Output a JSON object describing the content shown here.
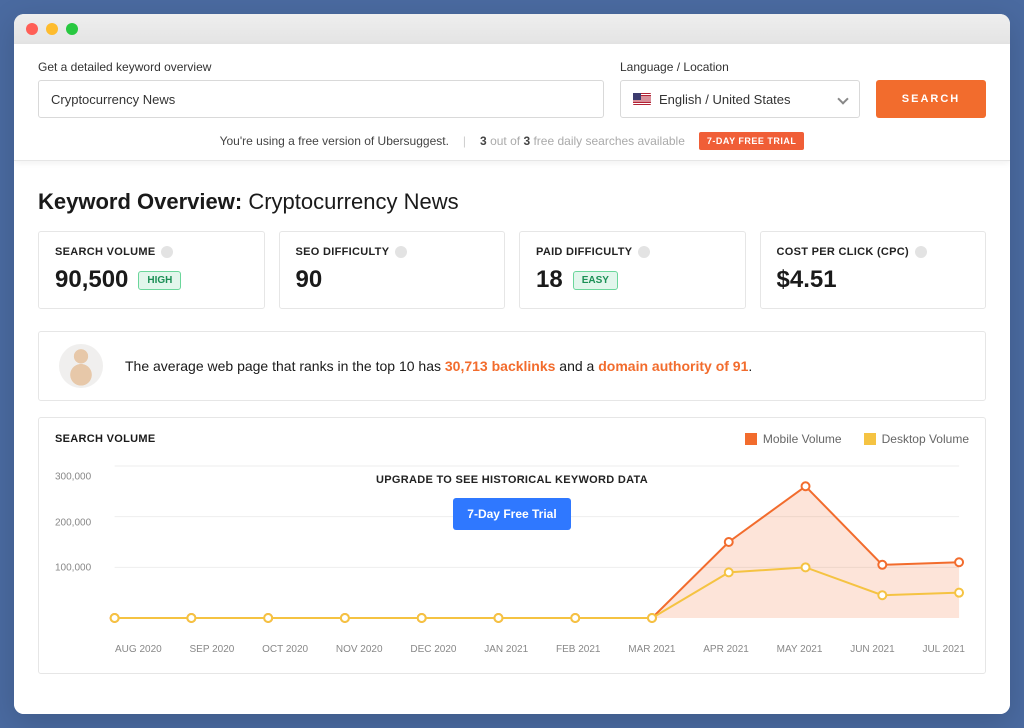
{
  "search": {
    "label": "Get a detailed keyword overview",
    "value": "Cryptocurrency News",
    "placeholder": ""
  },
  "location": {
    "label": "Language / Location",
    "value": "English / United States"
  },
  "search_button": "SEARCH",
  "subbar": {
    "free_version_text": "You're using a free version of Ubersuggest.",
    "searches_before": "3",
    "out_of": " out of ",
    "searches_after_num": "3",
    "searches_after_text": " free daily searches available",
    "trial_chip": "7-DAY FREE TRIAL"
  },
  "title_prefix": "Keyword Overview:",
  "title_keyword": "Cryptocurrency News",
  "cards": {
    "volume": {
      "label": "SEARCH VOLUME",
      "value": "90,500",
      "badge": "HIGH"
    },
    "seo": {
      "label": "SEO DIFFICULTY",
      "value": "90"
    },
    "paid": {
      "label": "PAID DIFFICULTY",
      "value": "18",
      "badge": "EASY"
    },
    "cpc": {
      "label": "COST PER CLICK (CPC)",
      "value": "$4.51"
    }
  },
  "insight": {
    "pre": "The average web page that ranks in the top 10 has ",
    "backlinks": "30,713 backlinks",
    "mid": " and a ",
    "da": "domain authority of 91",
    "post": "."
  },
  "chart": {
    "title": "SEARCH VOLUME",
    "overlay_text": "UPGRADE TO SEE HISTORICAL KEYWORD DATA",
    "trial_button": "7-Day Free Trial",
    "legend": {
      "mobile": "Mobile Volume",
      "desktop": "Desktop Volume"
    },
    "y_ticks": [
      "300,000",
      "200,000",
      "100,000"
    ]
  },
  "chart_data": {
    "type": "line",
    "categories": [
      "AUG 2020",
      "SEP 2020",
      "OCT 2020",
      "NOV 2020",
      "DEC 2020",
      "JAN 2021",
      "FEB 2021",
      "MAR 2021",
      "APR 2021",
      "MAY 2021",
      "JUN 2021",
      "JUL 2021"
    ],
    "series": [
      {
        "name": "Mobile Volume",
        "color": "#f26c2d",
        "values": [
          0,
          0,
          0,
          0,
          0,
          0,
          0,
          0,
          150000,
          260000,
          105000,
          110000
        ]
      },
      {
        "name": "Desktop Volume",
        "color": "#f5c342",
        "values": [
          0,
          0,
          0,
          0,
          0,
          0,
          0,
          0,
          90000,
          100000,
          45000,
          50000
        ]
      }
    ],
    "ylim": [
      0,
      300000
    ],
    "ylabel": "",
    "xlabel": "",
    "title": "SEARCH VOLUME"
  }
}
